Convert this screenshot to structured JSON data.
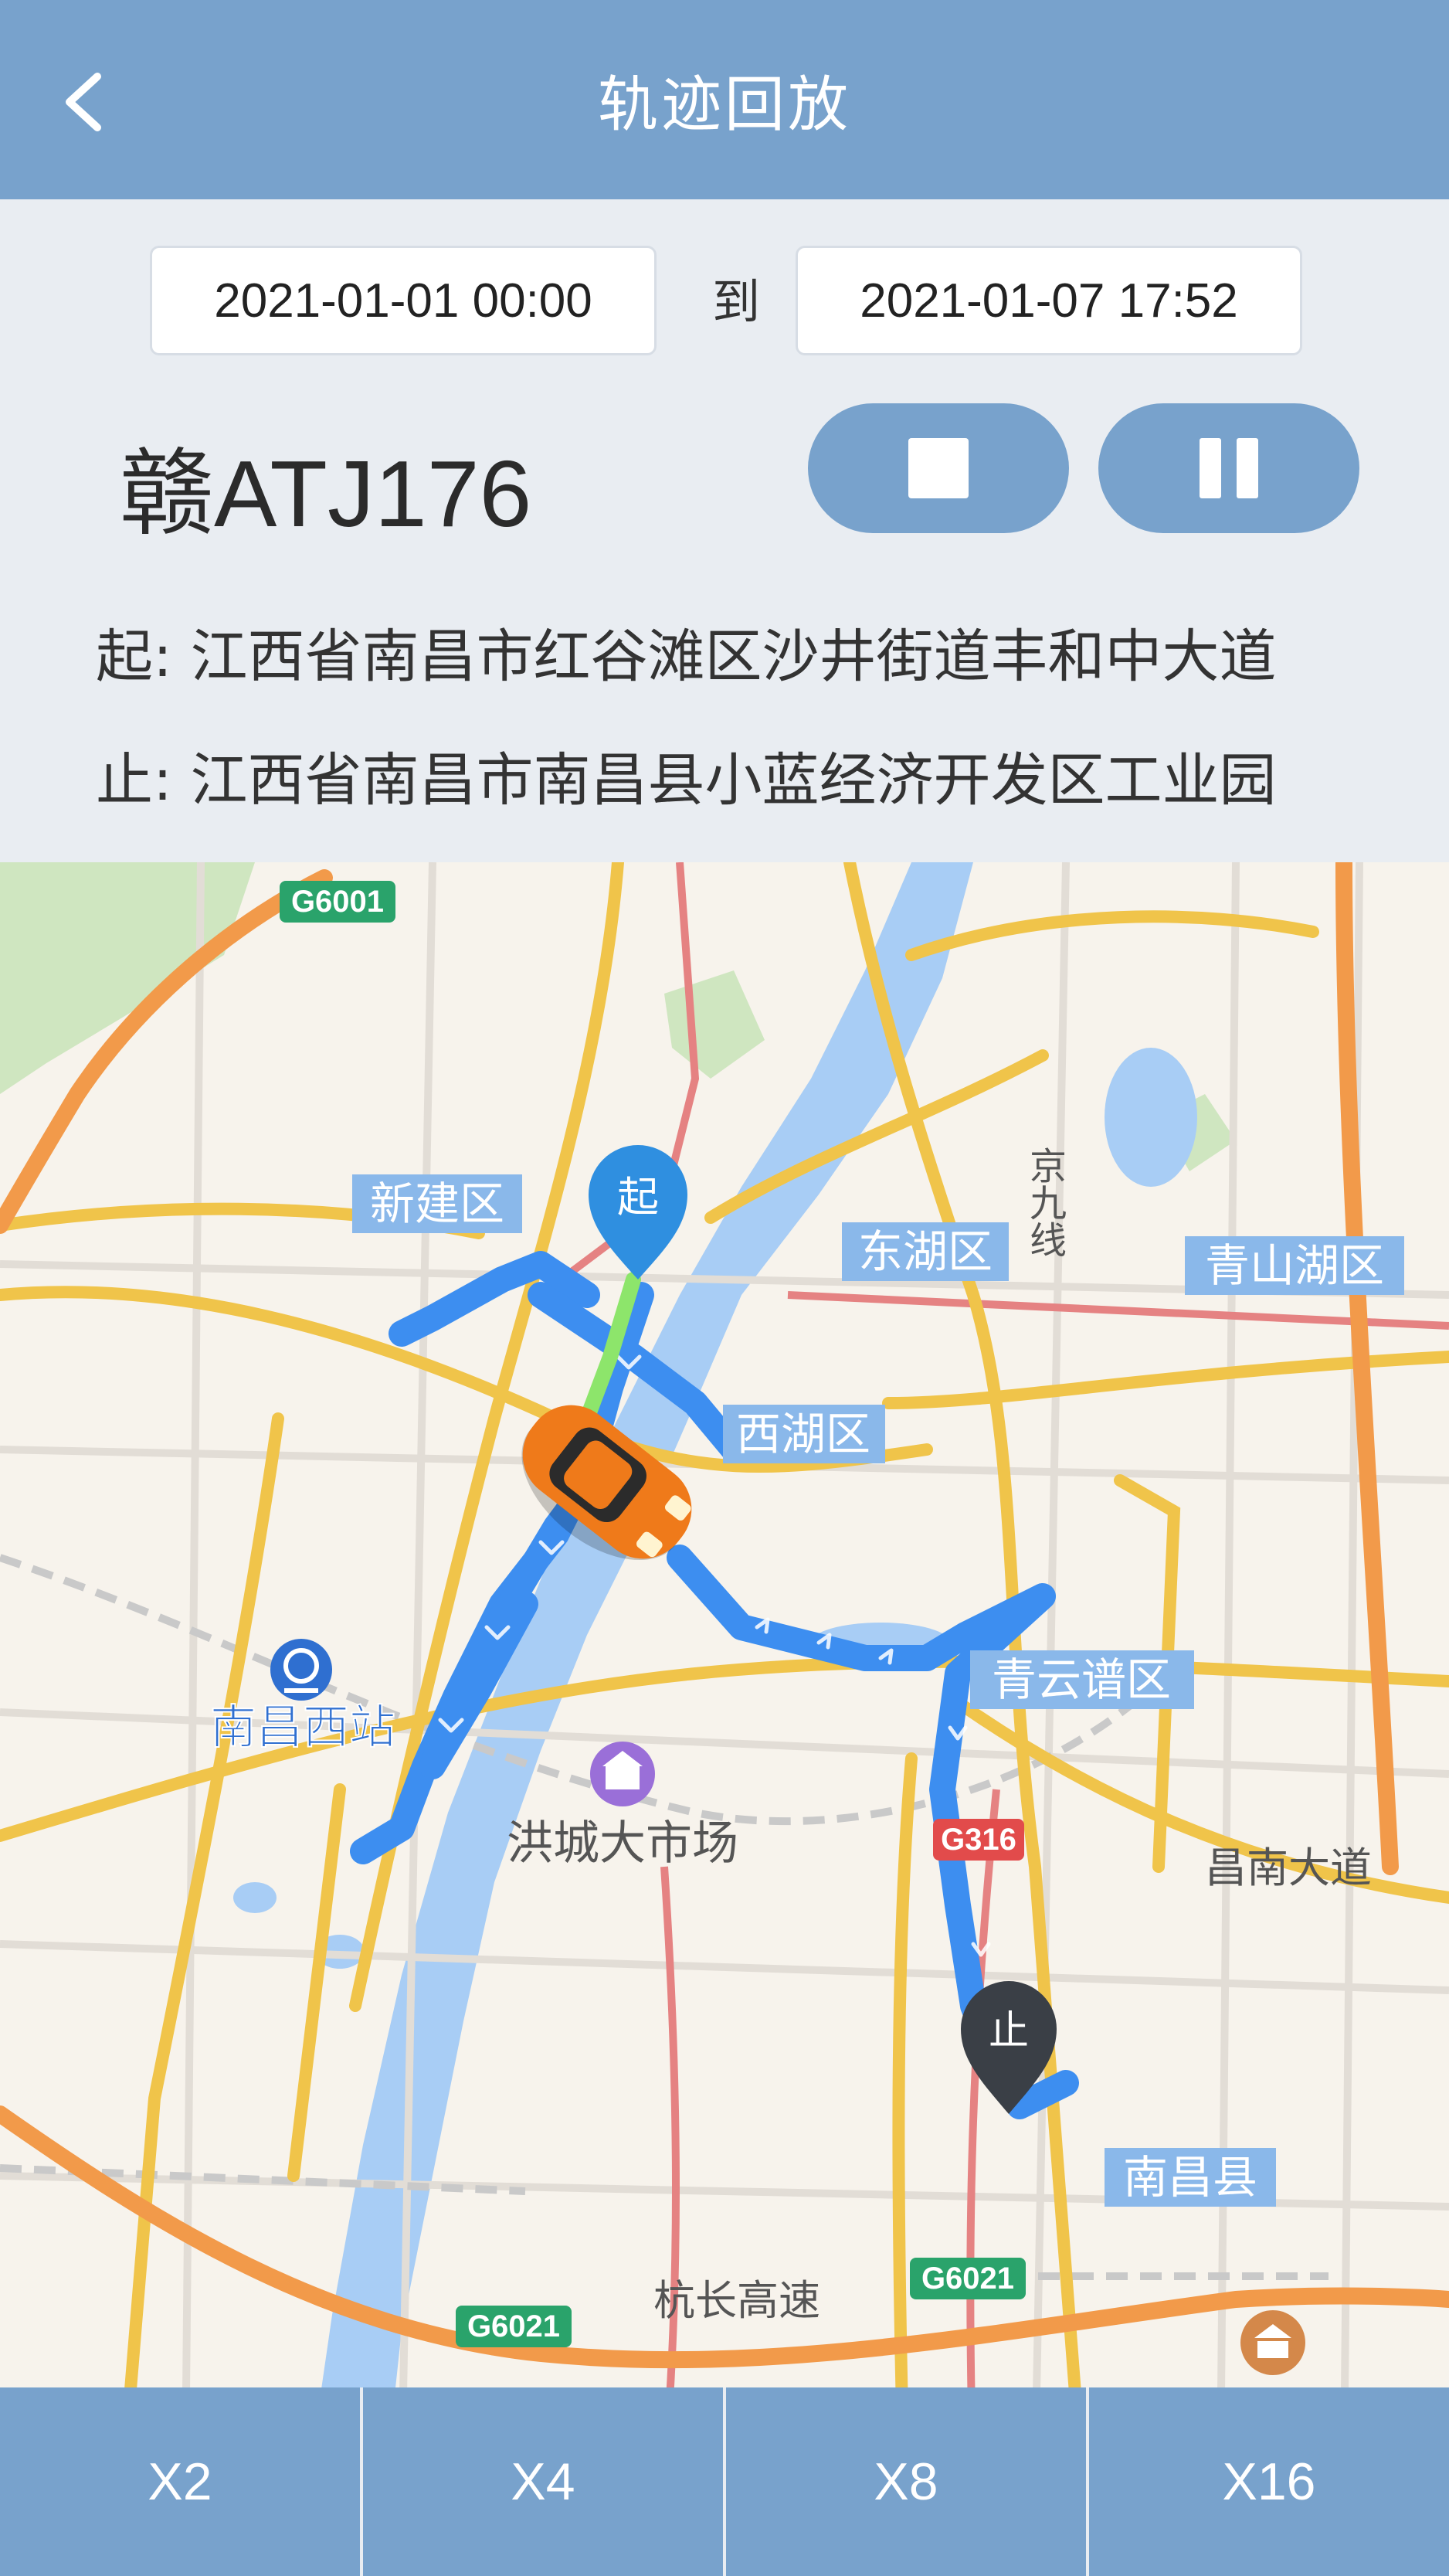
{
  "header": {
    "title": "轨迹回放",
    "back_icon": "chevron-left-icon"
  },
  "time_range": {
    "start": "2021-01-01 00:00",
    "to_label": "到",
    "end": "2021-01-07 17:52"
  },
  "vehicle": {
    "plate": "赣ATJ176"
  },
  "controls": {
    "stop_icon": "stop-icon",
    "pause_icon": "pause-icon"
  },
  "addresses": {
    "start": "起: 江西省南昌市红谷滩区沙井街道丰和中大道",
    "end": "止: 江西省南昌市南昌县小蓝经济开发区工业园"
  },
  "map": {
    "start_marker": "起",
    "end_marker": "止",
    "labels": {
      "xinjian": "新建区",
      "donghu": "东湖区",
      "qingshanhu": "青山湖区",
      "xihu": "西湖区",
      "qingyunpu": "青云谱区",
      "nanchangxi": "南昌西站",
      "hongcheng": "洪城大市场",
      "nanchangxian": "南昌县",
      "jingjiu": "京九线",
      "changnan": "昌南大道",
      "hangchang": "杭长高速",
      "g6001": "G6001",
      "g6021a": "G6021",
      "g6021b": "G6021",
      "g316": "G316"
    }
  },
  "speed_options": [
    "X2",
    "X4",
    "X8",
    "X16"
  ],
  "colors": {
    "primary": "#78a2cc",
    "background": "#e9edf2",
    "track": "#3d8ef0",
    "start_marker": "#2f8fe0",
    "end_marker": "#3a3f46",
    "car": "#ef7a1a"
  }
}
